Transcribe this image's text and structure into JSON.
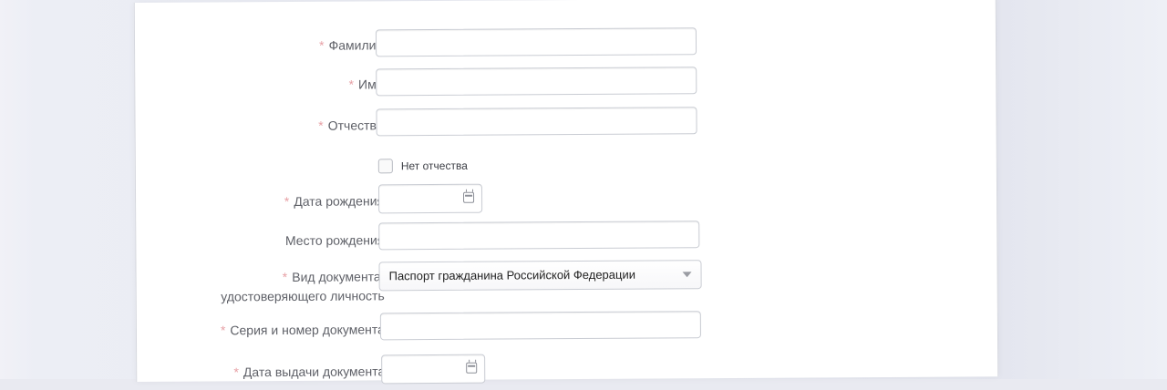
{
  "form": {
    "fields": {
      "surname": {
        "label": "Фамилия",
        "value": ""
      },
      "name": {
        "label": "Имя",
        "value": ""
      },
      "patronymic": {
        "label": "Отчество",
        "value": ""
      },
      "no_patronymic": {
        "label": "Нет отчества",
        "checked": false
      },
      "birth_date": {
        "label": "Дата рождения",
        "value": ""
      },
      "birth_place": {
        "label": "Место рождения",
        "value": ""
      },
      "document_type": {
        "label_line1": "Вид документа,",
        "label_line2": "удостоверяющего личность",
        "selected": "Паспорт гражданина Российской Федерации"
      },
      "document_number": {
        "label": "Серия и номер документа",
        "value": ""
      },
      "issue_date": {
        "label": "Дата выдачи документа",
        "value": ""
      }
    },
    "required_marker": "*"
  },
  "colors": {
    "required_marker": "#e7a0a5",
    "label_text": "#5f6168",
    "input_border": "#c9ccd3"
  },
  "icons": {
    "date_picker": "calendar-icon",
    "select": "chevron-down-icon"
  }
}
